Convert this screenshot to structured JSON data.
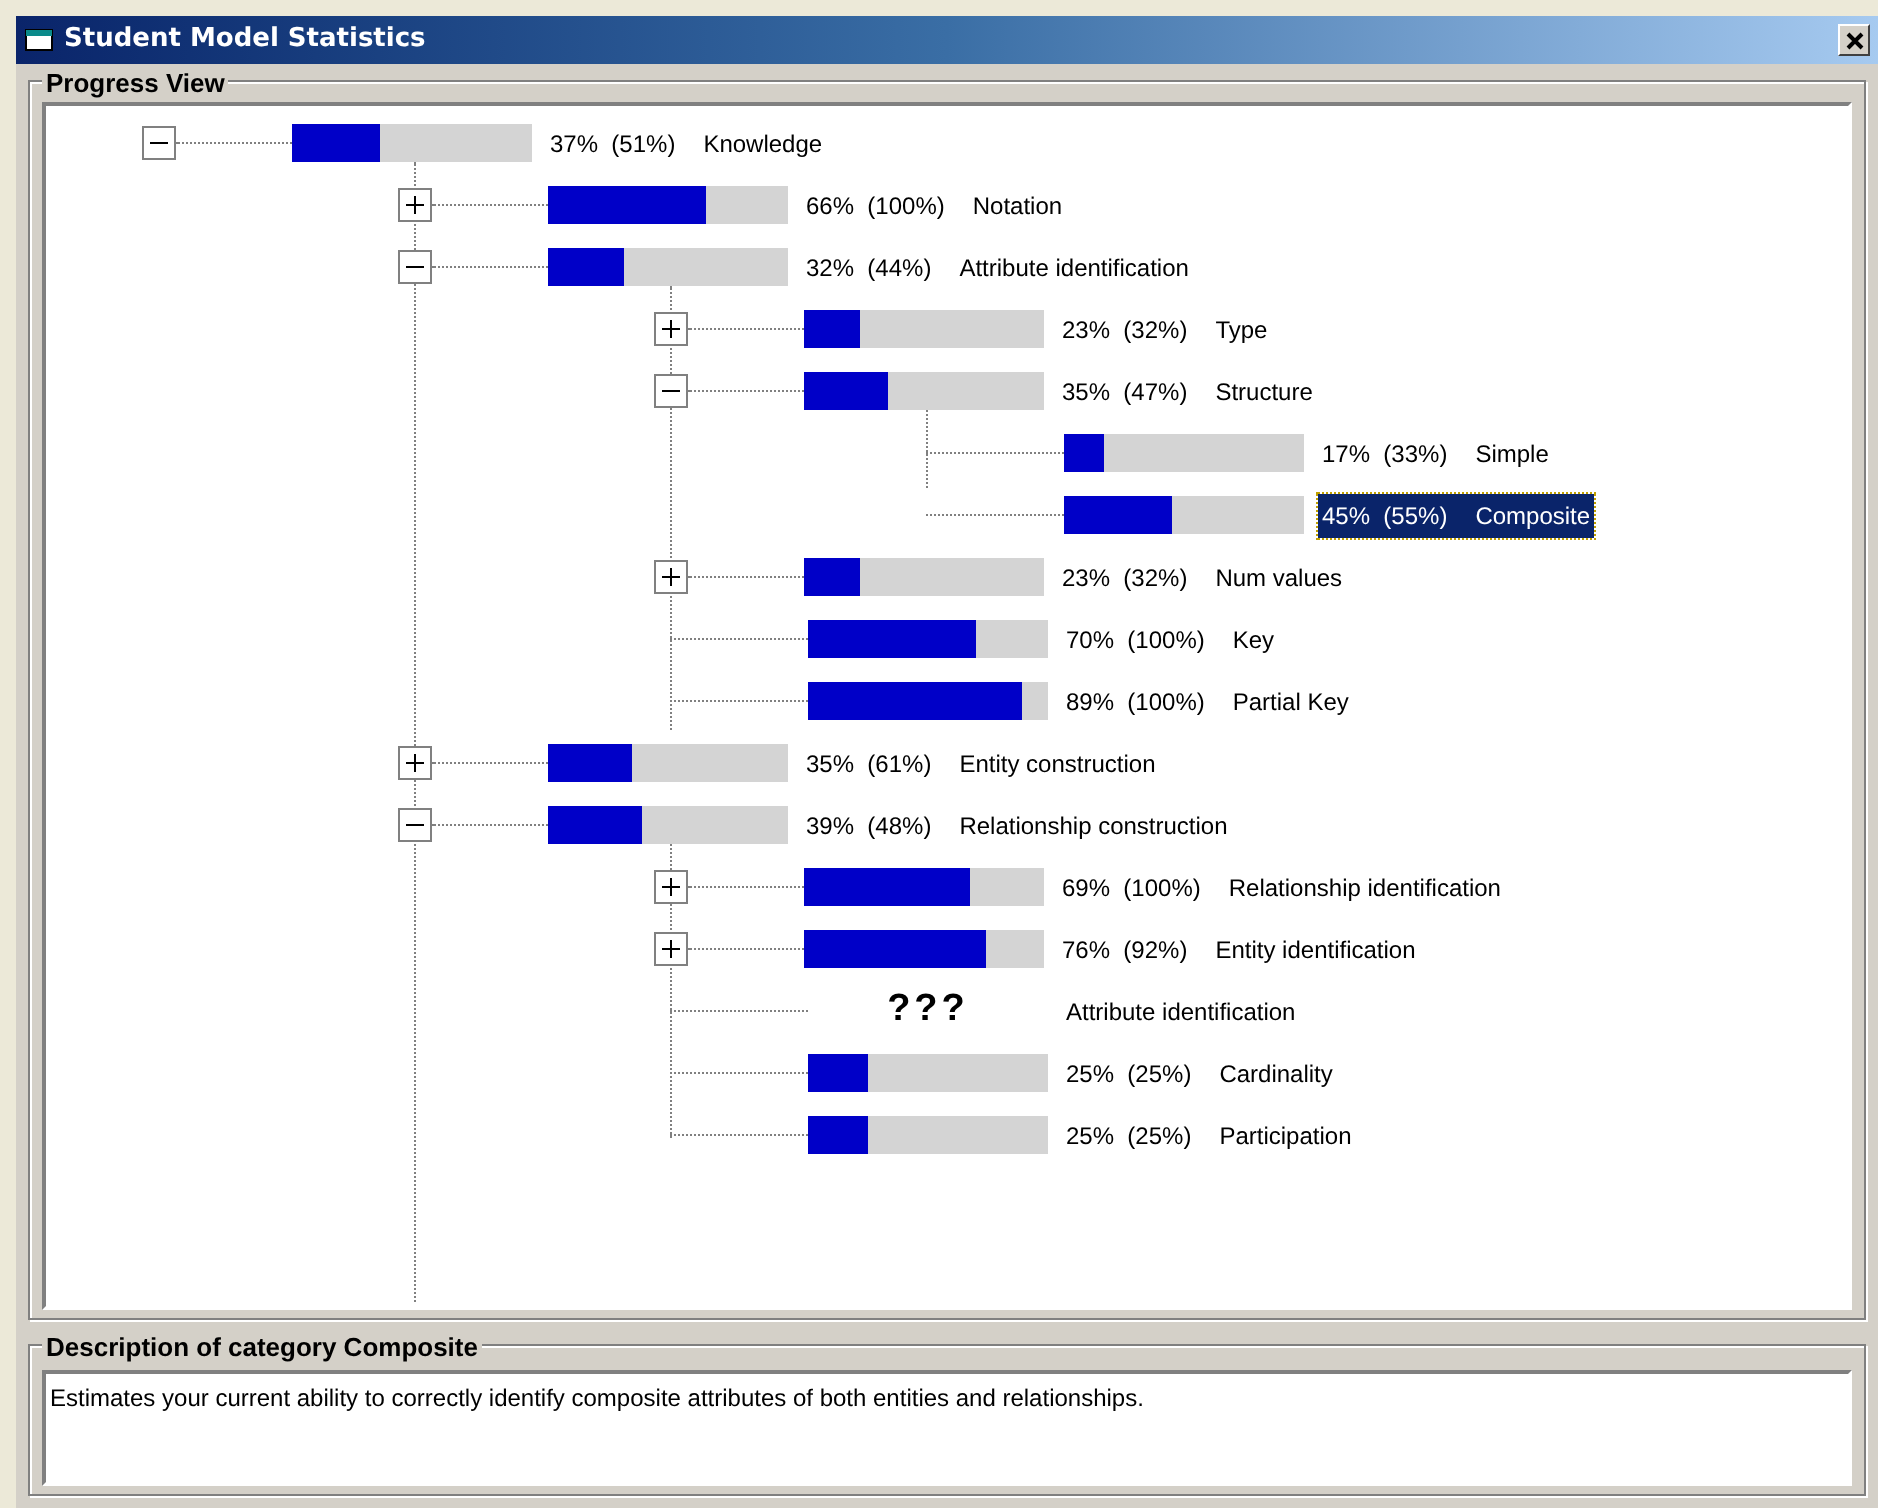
{
  "window": {
    "title": "Student Model Statistics"
  },
  "progress_view": {
    "title": "Progress View",
    "tree": [
      {
        "score": "37%  (51%)",
        "label": "Knowledge",
        "level": 0.37,
        "expanded": true,
        "selected": false,
        "children": [
          {
            "score": "66%  (100%)",
            "label": "Notation",
            "level": 0.66,
            "expanded": false,
            "selected": false
          },
          {
            "score": "32%  (44%)",
            "label": "Attribute identification",
            "level": 0.32,
            "expanded": true,
            "selected": false,
            "children": [
              {
                "score": "23%  (32%)",
                "label": "Type",
                "level": 0.23,
                "expanded": false,
                "selected": false
              },
              {
                "score": "35%  (47%)",
                "label": "Structure",
                "level": 0.35,
                "expanded": true,
                "selected": false,
                "children": [
                  {
                    "score": "17%  (33%)",
                    "label": "Simple",
                    "level": 0.17,
                    "selected": false
                  },
                  {
                    "score": "45%  (55%)",
                    "label": "Composite",
                    "level": 0.45,
                    "selected": true
                  }
                ]
              },
              {
                "score": "23%  (32%)",
                "label": "Num values",
                "level": 0.23,
                "expanded": false,
                "selected": false
              },
              {
                "score": "70%  (100%)",
                "label": "Key",
                "level": 0.7,
                "selected": false
              },
              {
                "score": "89%  (100%)",
                "label": "Partial Key",
                "level": 0.89,
                "selected": false
              }
            ]
          },
          {
            "score": "35%  (61%)",
            "label": "Entity construction",
            "level": 0.35,
            "expanded": false,
            "selected": false
          },
          {
            "score": "39%  (48%)",
            "label": "Relationship construction",
            "level": 0.39,
            "expanded": true,
            "selected": false,
            "children": [
              {
                "score": "69%  (100%)",
                "label": "Relationship identification",
                "level": 0.69,
                "expanded": false,
                "selected": false
              },
              {
                "score": "76%  (92%)",
                "label": "Entity identification",
                "level": 0.76,
                "expanded": false,
                "selected": false
              },
              {
                "kind": "unknown",
                "marker": "???",
                "label": "Attribute identification",
                "selected": false
              },
              {
                "score": "25%  (25%)",
                "label": "Cardinality",
                "level": 0.25,
                "selected": false
              },
              {
                "score": "25%  (25%)",
                "label": "Participation",
                "level": 0.25,
                "selected": false
              }
            ]
          }
        ]
      }
    ]
  },
  "description": {
    "title": "Description of category Composite",
    "text": "Estimates your current ability to correctly identify composite attributes of both entities and relationships."
  }
}
